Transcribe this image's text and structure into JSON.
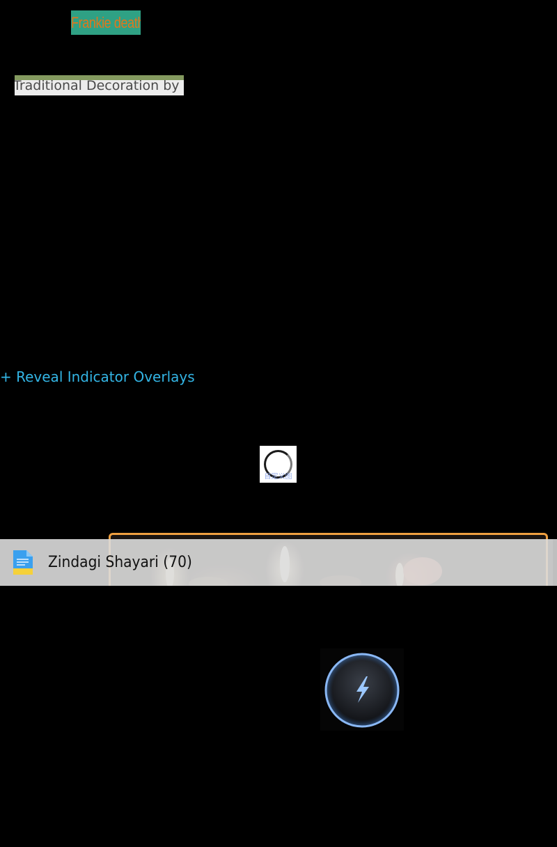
{
  "tags": {
    "frankie": "Frankie death",
    "traditional": "Traditional Decoration by"
  },
  "reveal": {
    "label": "+ Reveal Indicator Overlays"
  },
  "spinner": {
    "faint_text": "自定义图"
  },
  "file_row": {
    "icon": "document-icon",
    "label": "Zindagi Shayari (70)"
  },
  "boost": {
    "icon": "lightning-bolt-icon"
  },
  "colors": {
    "link": "#33b5e5",
    "frankie_bg": "#2fa184",
    "frankie_text": "#e0771c",
    "card_border": "#f0a040",
    "boost_ring": "#8ab8f5"
  }
}
